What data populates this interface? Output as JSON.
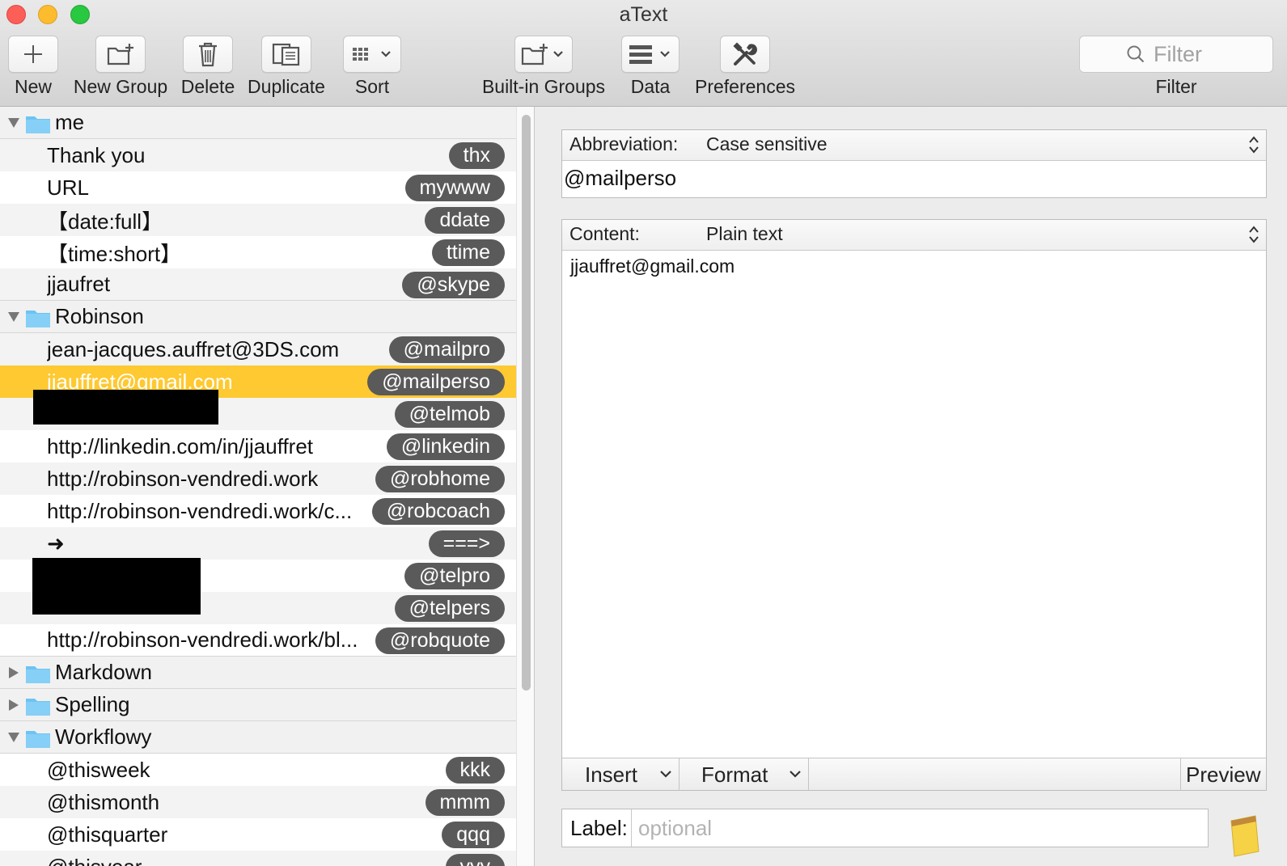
{
  "window": {
    "title": "aText"
  },
  "toolbar": {
    "new": "New",
    "new_group": "New Group",
    "delete": "Delete",
    "duplicate": "Duplicate",
    "sort": "Sort",
    "builtin_groups": "Built-in Groups",
    "data": "Data",
    "preferences": "Preferences",
    "filter_label": "Filter",
    "filter_placeholder": "Filter"
  },
  "groups": {
    "me": {
      "name": "me",
      "expanded": true,
      "items": [
        {
          "label": "Thank you",
          "abbr": "thx"
        },
        {
          "label": "URL",
          "abbr": "mywww"
        },
        {
          "label": "【date:full】",
          "abbr": "ddate"
        },
        {
          "label": "【time:short】",
          "abbr": "ttime"
        },
        {
          "label": "jjaufret",
          "abbr": "@skype"
        }
      ]
    },
    "robinson": {
      "name": "Robinson",
      "expanded": true,
      "items": [
        {
          "label": "jean-jacques.auffret@3DS.com",
          "abbr": "@mailpro"
        },
        {
          "label": "jjauffret@gmail.com",
          "abbr": "@mailperso",
          "selected": true
        },
        {
          "label": "",
          "abbr": "@telmob",
          "redacted": true
        },
        {
          "label": "http://linkedin.com/in/jjauffret",
          "abbr": "@linkedin"
        },
        {
          "label": "http://robinson-vendredi.work",
          "abbr": "@robhome"
        },
        {
          "label": "http://robinson-vendredi.work/c...",
          "abbr": "@robcoach"
        },
        {
          "label": "➜",
          "abbr": "===>"
        },
        {
          "label": "",
          "abbr": "@telpro",
          "redacted": true
        },
        {
          "label": "",
          "abbr": "@telpers",
          "redacted": true
        },
        {
          "label": "http://robinson-vendredi.work/bl...",
          "abbr": "@robquote"
        }
      ]
    },
    "markdown": {
      "name": "Markdown",
      "expanded": false
    },
    "spelling": {
      "name": "Spelling",
      "expanded": false
    },
    "workflowy": {
      "name": "Workflowy",
      "expanded": true,
      "items": [
        {
          "label": "@thisweek",
          "abbr": "kkk"
        },
        {
          "label": "@thismonth",
          "abbr": "mmm"
        },
        {
          "label": "@thisquarter",
          "abbr": "qqq"
        },
        {
          "label": "@thisyear",
          "abbr": "yyy"
        }
      ]
    }
  },
  "editor": {
    "abbreviation_title": "Abbreviation:",
    "abbreviation_mode": "Case sensitive",
    "abbreviation_value": "@mailperso",
    "content_title": "Content:",
    "content_mode": "Plain text",
    "content_value": "jjauffret@gmail.com",
    "insert_label": "Insert",
    "format_label": "Format",
    "preview_label": "Preview",
    "label_title": "Label:",
    "label_placeholder": "optional"
  },
  "colors": {
    "selection": "#fec931",
    "badge": "#5a5a5a",
    "folder": "#6ec3f3"
  }
}
